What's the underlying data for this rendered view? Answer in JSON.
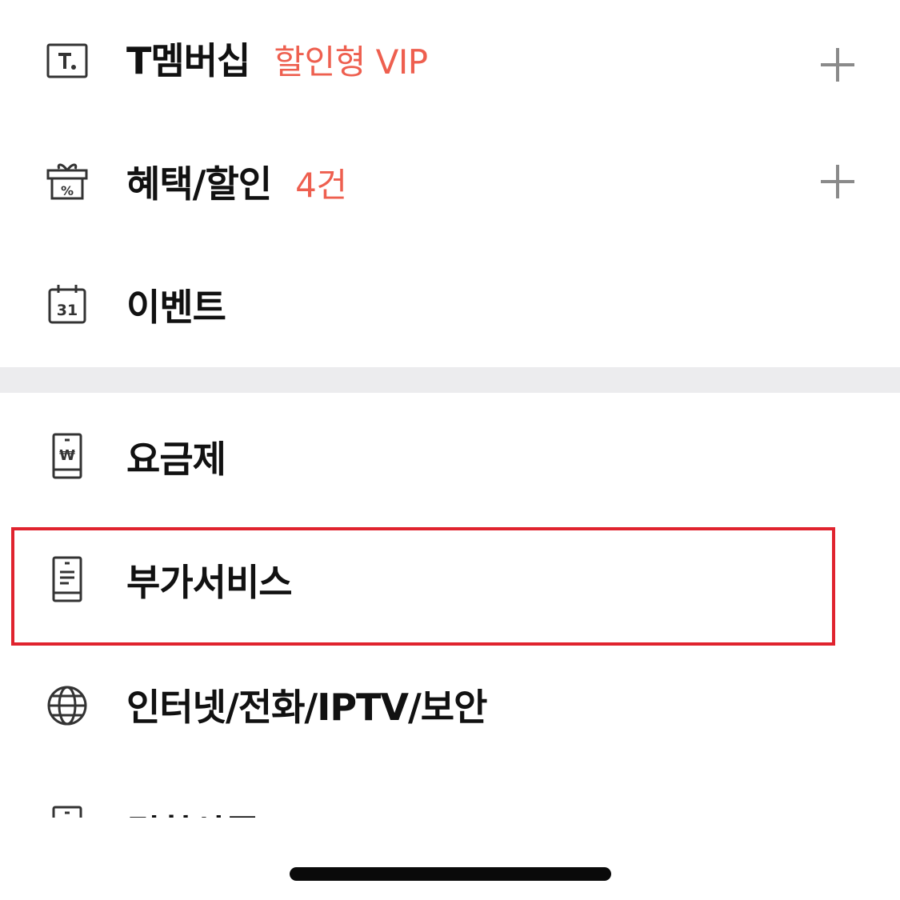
{
  "menu": {
    "top_items": [
      {
        "label": "T멤버십",
        "badge": "할인형 VIP",
        "icon": "t-membership-icon",
        "expandable": true
      },
      {
        "label": "혜택/할인",
        "badge": "4건",
        "icon": "gift-percent-icon",
        "expandable": true
      },
      {
        "label": "이벤트",
        "icon": "calendar-31-icon",
        "calendar_day": "31",
        "expandable": false
      }
    ],
    "service_items": [
      {
        "label": "요금제",
        "icon": "phone-won-icon",
        "won_symbol": "₩"
      },
      {
        "label": "부가서비스",
        "icon": "phone-document-icon",
        "highlighted": true
      },
      {
        "label": "인터넷/전화/IPTV/보안",
        "icon": "globe-icon"
      },
      {
        "label": "결합상품",
        "icon": "phone-document-icon"
      }
    ]
  },
  "colors": {
    "badge": "#ee5f4f",
    "highlight_border": "#e0232e",
    "divider": "#ececee",
    "plus_icon": "#8a8a8a",
    "text": "#111111"
  }
}
